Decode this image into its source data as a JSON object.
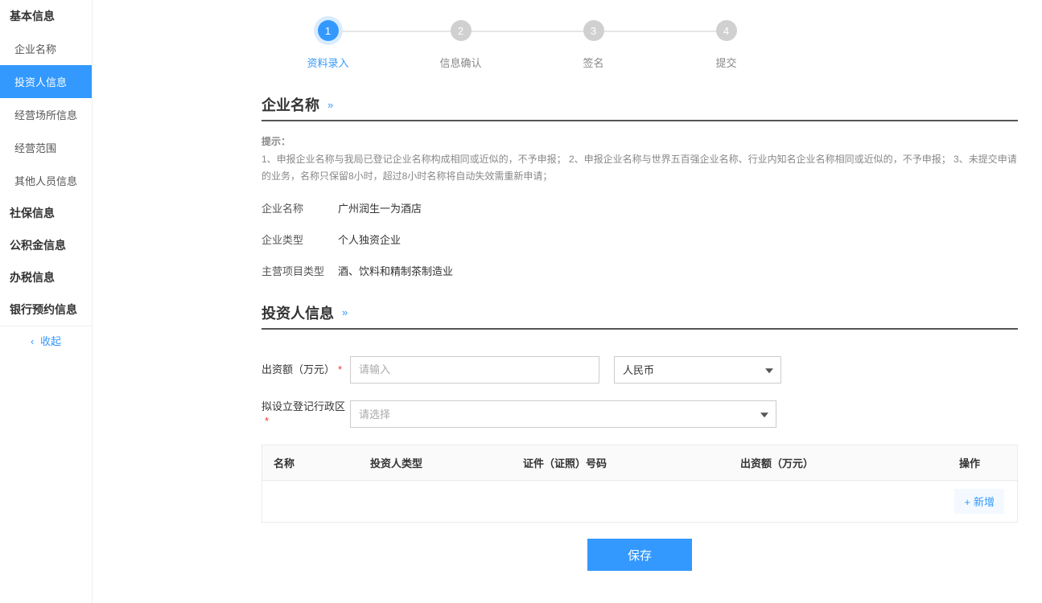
{
  "sidebar": {
    "groups": [
      {
        "title": "基本信息",
        "items": [
          "企业名称",
          "投资人信息",
          "经营场所信息",
          "经营范围",
          "其他人员信息"
        ]
      },
      {
        "title": "社保信息",
        "items": []
      },
      {
        "title": "公积金信息",
        "items": []
      },
      {
        "title": "办税信息",
        "items": []
      },
      {
        "title": "银行预约信息",
        "items": []
      }
    ],
    "active_item": "投资人信息",
    "collapse_label": "收起"
  },
  "steps": [
    {
      "num": "1",
      "label": "资料录入",
      "active": true
    },
    {
      "num": "2",
      "label": "信息确认",
      "active": false
    },
    {
      "num": "3",
      "label": "签名",
      "active": false
    },
    {
      "num": "4",
      "label": "提交",
      "active": false
    }
  ],
  "sections": {
    "company": {
      "title": "企业名称",
      "hint_title": "提示：",
      "hint_body": "1、申报企业名称与我局已登记企业名称构成相同或近似的，不予申报； 2、申报企业名称与世界五百强企业名称、行业内知名企业名称相同或近似的，不予申报； 3、未提交申请的业务，名称只保留8小时，超过8小时名称将自动失效需重新申请；",
      "name_label": "企业名称",
      "name_value": "广州润生一为酒店",
      "type_label": "企业类型",
      "type_value": "个人独资企业",
      "cat_label": "主营项目类型",
      "cat_value": "酒、饮料和精制茶制造业"
    },
    "investor": {
      "title": "投资人信息",
      "amount_label": "出资额（万元）",
      "amount_placeholder": "请输入",
      "currency_value": "人民币",
      "region_label": "拟设立登记行政区",
      "region_placeholder": "请选择",
      "table": {
        "headers": {
          "name": "名称",
          "type": "投资人类型",
          "id": "证件（证照）号码",
          "amt": "出资额（万元）",
          "op": "操作"
        },
        "add_label": "新增"
      }
    }
  },
  "buttons": {
    "save": "保存"
  }
}
